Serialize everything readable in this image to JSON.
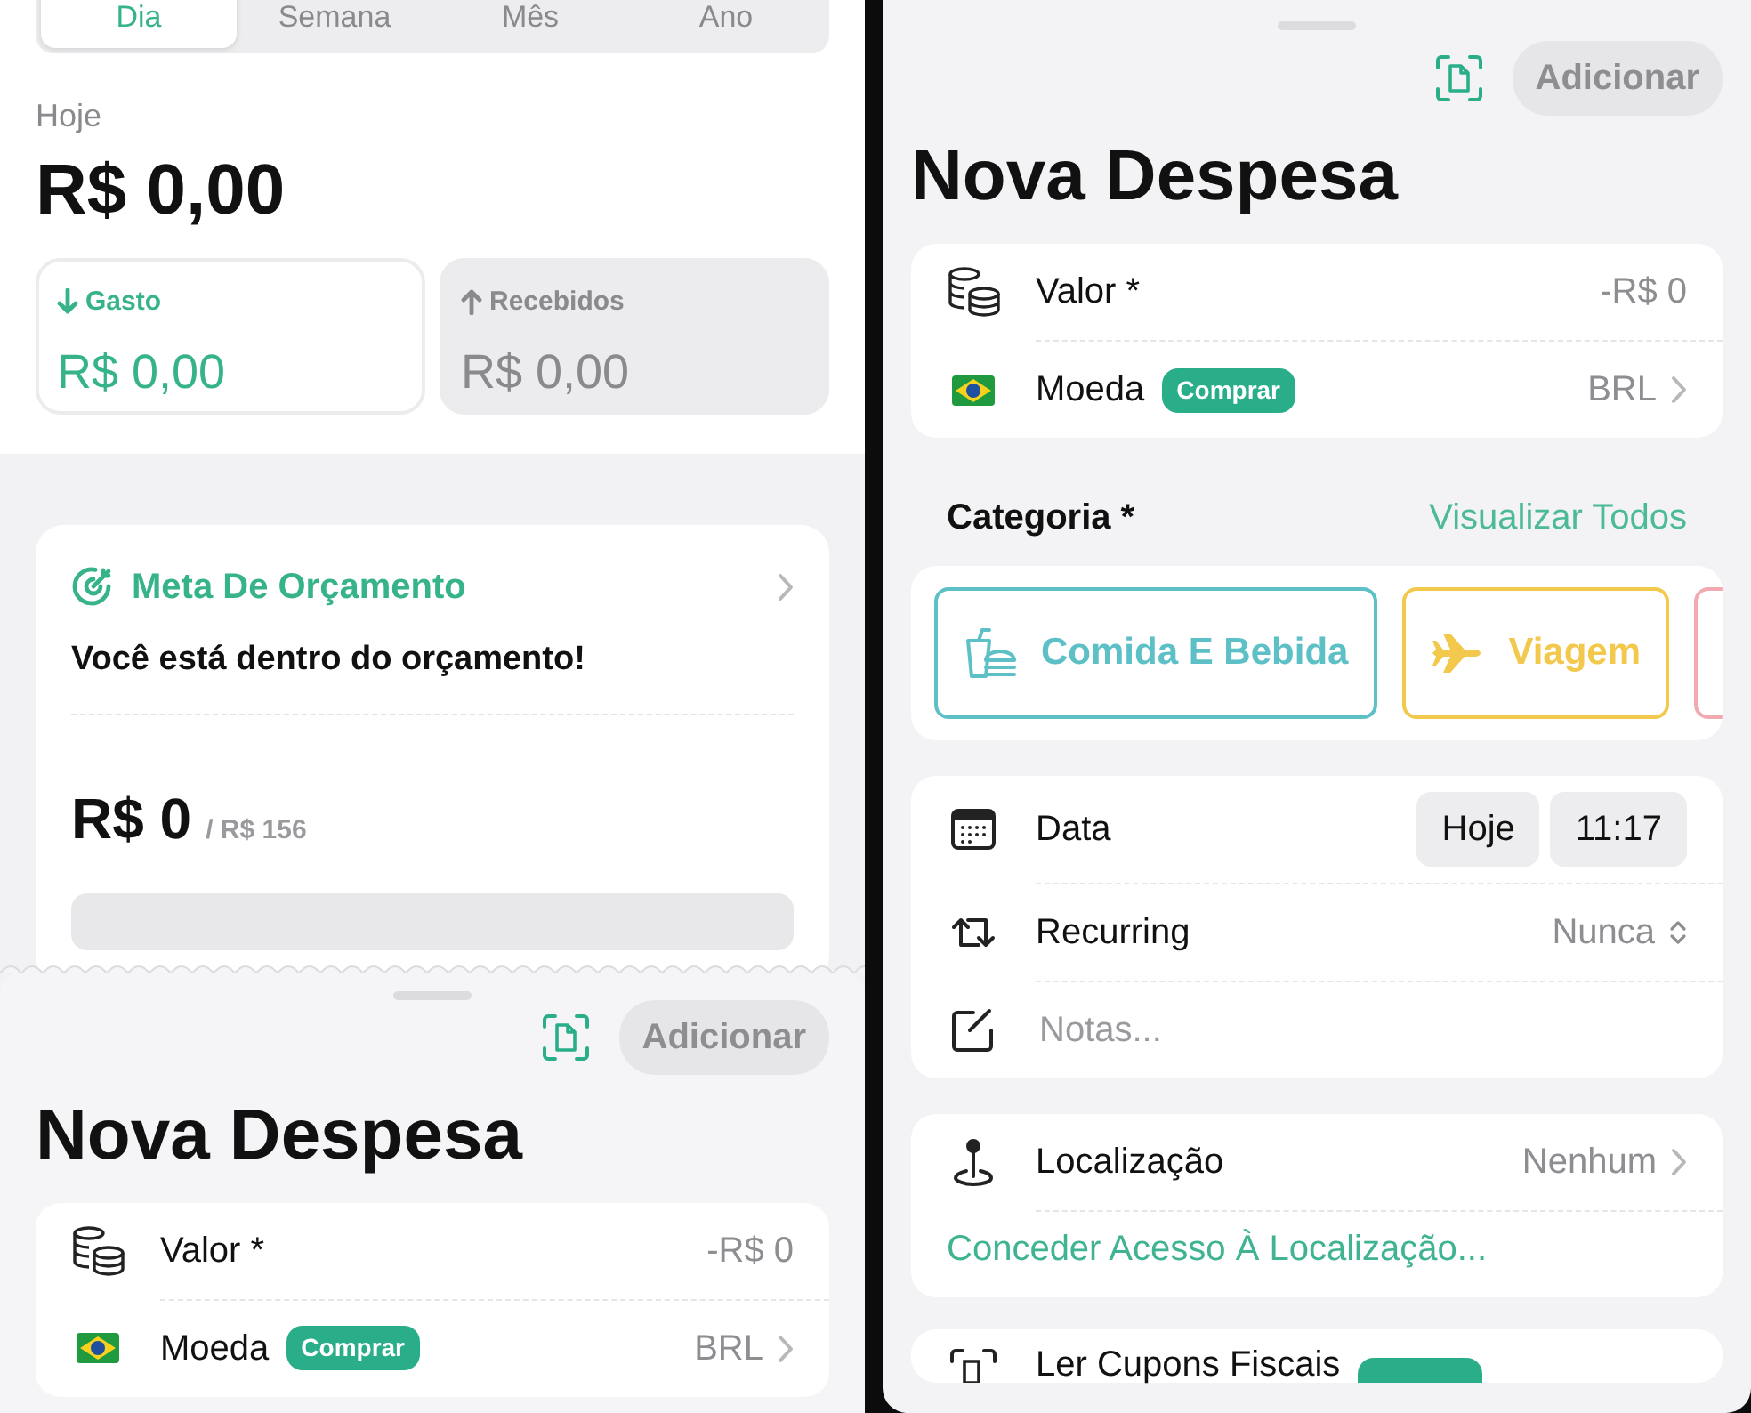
{
  "left_screen": {
    "tabs": [
      {
        "label": "Dia",
        "selected": true
      },
      {
        "label": "Semana",
        "selected": false
      },
      {
        "label": "Mês",
        "selected": false
      },
      {
        "label": "Ano",
        "selected": false
      }
    ],
    "period_label": "Hoje",
    "total": "R$ 0,00",
    "summary_cards": [
      {
        "kind": "expense",
        "label": "Gasto",
        "amount": "R$ 0,00",
        "selected": true
      },
      {
        "kind": "income",
        "label": "Recebidos",
        "amount": "R$ 0,00",
        "selected": false
      }
    ],
    "budget_card": {
      "title": "Meta De Orçamento",
      "message": "Você está dentro do orçamento!",
      "spent": "R$ 0",
      "limit": "/ R$ 156",
      "level": 0
    },
    "sheet": {
      "add_button": "Adicionar",
      "title": "Nova Despesa",
      "rows": [
        {
          "kind": "amount",
          "label": "Valor *",
          "value": "-R$ 0"
        },
        {
          "kind": "currency",
          "label": "Moeda",
          "badge": "Comprar",
          "value": "BRL"
        }
      ]
    }
  },
  "right_screen": {
    "sheet": {
      "add_button": "Adicionar",
      "title": "Nova Despesa",
      "rows": [
        {
          "kind": "amount",
          "label": "Valor *",
          "value": "-R$ 0"
        },
        {
          "kind": "currency",
          "label": "Moeda",
          "badge": "Comprar",
          "value": "BRL"
        }
      ]
    },
    "category_header": {
      "label": "Categoria *",
      "link": "Visualizar Todos"
    },
    "categories": [
      {
        "kind": "food",
        "label": "Comida E Bebida",
        "color": "#5cc0c6"
      },
      {
        "kind": "travel",
        "label": "Viagem",
        "color": "#f2c94c"
      },
      {
        "kind": "other",
        "color": "#f2aab2"
      }
    ],
    "details": [
      {
        "kind": "date",
        "label": "Data",
        "date": "Hoje",
        "time": "11:17"
      },
      {
        "kind": "recurring",
        "label": "Recurring",
        "value": "Nunca"
      },
      {
        "kind": "notes",
        "placeholder": "Notas..."
      }
    ],
    "location": {
      "label": "Localização",
      "value": "Nenhum",
      "link": "Conceder Acesso À Localização..."
    },
    "receipt_row": {
      "label": "Ler Cupons Fiscais"
    }
  }
}
